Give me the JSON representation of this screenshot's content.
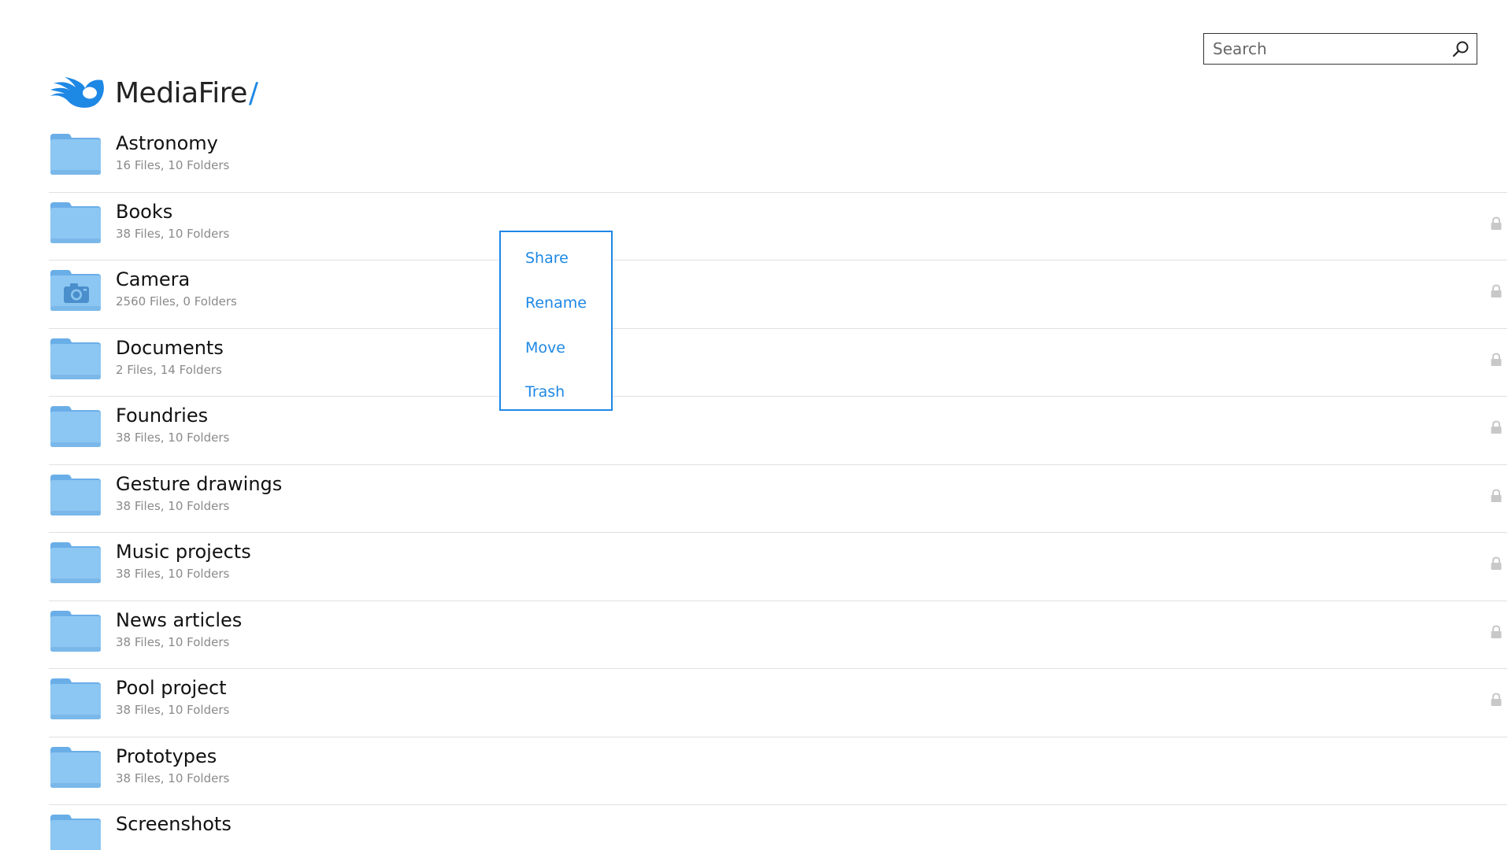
{
  "app": {
    "title": "MediaFire",
    "title_suffix": "/",
    "logo_icon": "mediafire-flame-logo",
    "accent_color": "#1e88e5"
  },
  "search": {
    "placeholder": "Search",
    "value": "",
    "icon": "search-icon"
  },
  "folders": [
    {
      "name": "Astronomy",
      "meta": "16 Files, 10 Folders",
      "icon": "folder-icon",
      "locked": false
    },
    {
      "name": "Books",
      "meta": "38 Files, 10 Folders",
      "icon": "folder-icon",
      "locked": true
    },
    {
      "name": "Camera",
      "meta": "2560 Files, 0 Folders",
      "icon": "camera-folder-icon",
      "locked": true
    },
    {
      "name": "Documents",
      "meta": "2 Files, 14 Folders",
      "icon": "folder-icon",
      "locked": true
    },
    {
      "name": "Foundries",
      "meta": "38 Files, 10 Folders",
      "icon": "folder-icon",
      "locked": true
    },
    {
      "name": "Gesture drawings",
      "meta": "38 Files, 10 Folders",
      "icon": "folder-icon",
      "locked": true
    },
    {
      "name": "Music projects",
      "meta": "38 Files, 10 Folders",
      "icon": "folder-icon",
      "locked": true
    },
    {
      "name": "News articles",
      "meta": "38 Files, 10 Folders",
      "icon": "folder-icon",
      "locked": true
    },
    {
      "name": "Pool project",
      "meta": "38 Files, 10 Folders",
      "icon": "folder-icon",
      "locked": true
    },
    {
      "name": "Prototypes",
      "meta": "38 Files, 10 Folders",
      "icon": "folder-icon",
      "locked": false
    },
    {
      "name": "Screenshots",
      "meta": "",
      "icon": "folder-icon",
      "locked": false
    }
  ],
  "context_menu": {
    "items": [
      "Share",
      "Rename",
      "Move",
      "Trash"
    ]
  }
}
